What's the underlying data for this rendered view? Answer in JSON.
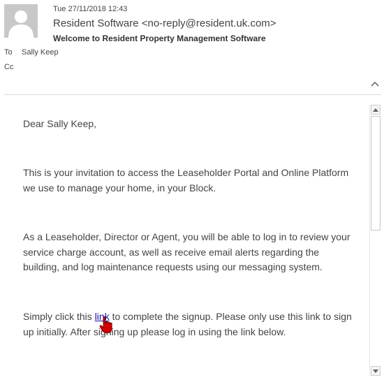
{
  "header": {
    "date": "Tue 27/11/2018 12:43",
    "sender": "Resident Software <no-reply@resident.uk.com>",
    "subject": "Welcome to Resident Property Management Software",
    "to_label": "To",
    "to_value": "Sally Keep",
    "cc_label": "Cc"
  },
  "body": {
    "greeting": "Dear Sally Keep,",
    "para1": "This is your invitation to access the Leaseholder Portal and Online Platform we use to manage your home, in your Block.",
    "para2": "As a Leaseholder, Director or Agent, you will be able to log in to review your service charge account, as well as receive email alerts regarding the building, and log maintenance requests using our messaging system.",
    "para3_before": "Simply click this ",
    "para3_link": "link",
    "para3_after": " to complete the signup. Please only use this link to sign up initially. After signing up please log in using the link below."
  },
  "icons": {
    "avatar": "person-silhouette-icon",
    "collapse": "chevron-up-icon",
    "cursor": "hand-pointer-icon",
    "scroll_up": "arrow-up-icon",
    "scroll_down": "arrow-down-icon"
  },
  "colors": {
    "link": "#1a0dab",
    "avatar_bg": "#c8c8c8",
    "cursor": "#d40000"
  }
}
